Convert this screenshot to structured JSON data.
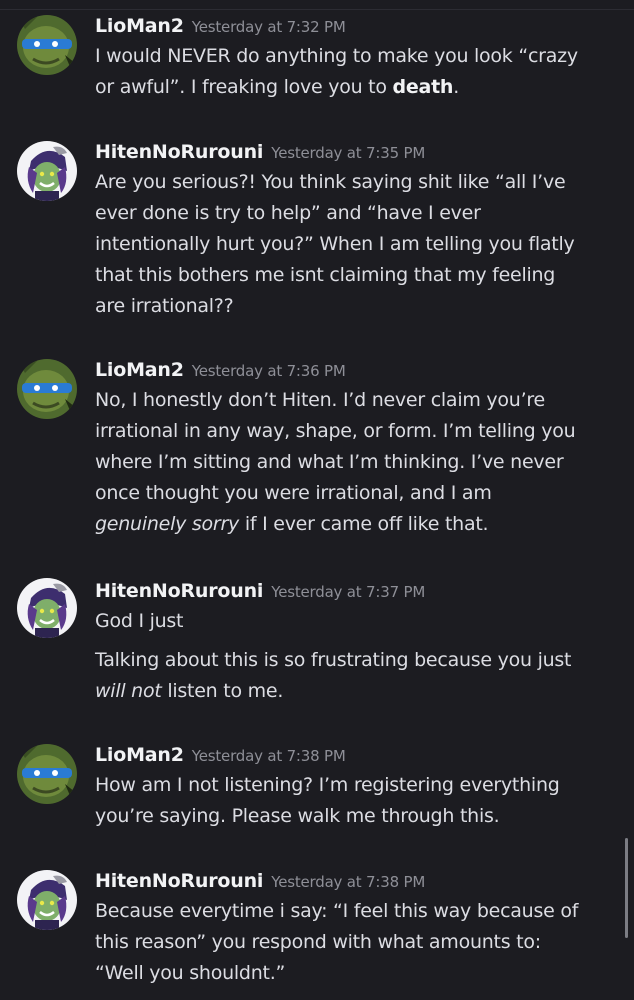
{
  "colors": {
    "background": "#1c1c21",
    "username": "#f2f3f5",
    "timestamp": "#8e8f97",
    "message_text": "#dcdde3"
  },
  "messages": [
    {
      "author": "LioMan2",
      "avatar_icon": "turtle-avatar-icon",
      "timestamp": "Yesterday at 7:32 PM",
      "lines": [
        [
          "I would NEVER do anything to make you look “crazy"
        ],
        [
          "or awful”. I freaking love you to ",
          "death",
          "."
        ]
      ]
    },
    {
      "author": "HitenNoRurouni",
      "avatar_icon": "purple-hair-character-avatar-icon",
      "timestamp": "Yesterday at 7:35 PM",
      "lines": [
        [
          "Are you serious?! You think saying shit like “all I’ve"
        ],
        [
          "ever done is try to help” and “have I ever"
        ],
        [
          "intentionally hurt you?” When I am telling you flatly"
        ],
        [
          "that this bothers me isnt claiming that my feeling"
        ],
        [
          "are irrational??"
        ]
      ]
    },
    {
      "author": "LioMan2",
      "avatar_icon": "turtle-avatar-icon",
      "timestamp": "Yesterday at 7:36 PM",
      "lines": [
        [
          "No, I honestly don’t Hiten. I’d never claim you’re"
        ],
        [
          "irrational in any way, shape, or form. I’m telling you"
        ],
        [
          "where I’m sitting and what I’m thinking. I’ve never"
        ],
        [
          "once thought you were irrational, and I am"
        ],
        [
          "genuinely sorry",
          " if I ever came off like that."
        ]
      ]
    },
    {
      "author": "HitenNoRurouni",
      "avatar_icon": "purple-hair-character-avatar-icon",
      "timestamp": "Yesterday at 7:37 PM",
      "lines_first": [
        "God I just"
      ],
      "lines_second": [
        [
          "Talking about this is so frustrating because you just"
        ],
        [
          "will not",
          " listen to me."
        ]
      ]
    },
    {
      "author": "LioMan2",
      "avatar_icon": "turtle-avatar-icon",
      "timestamp": "Yesterday at 7:38 PM",
      "lines": [
        [
          "How am I not listening? I’m registering everything"
        ],
        [
          "you’re saying. Please walk me through this."
        ]
      ]
    },
    {
      "author": "HitenNoRurouni",
      "avatar_icon": "purple-hair-character-avatar-icon",
      "timestamp": "Yesterday at 7:38 PM",
      "lines": [
        [
          "Because everytime i say: “I feel this way because of"
        ],
        [
          "this reason” you respond with what amounts to:"
        ],
        [
          "“Well you shouldnt.”"
        ]
      ]
    }
  ]
}
